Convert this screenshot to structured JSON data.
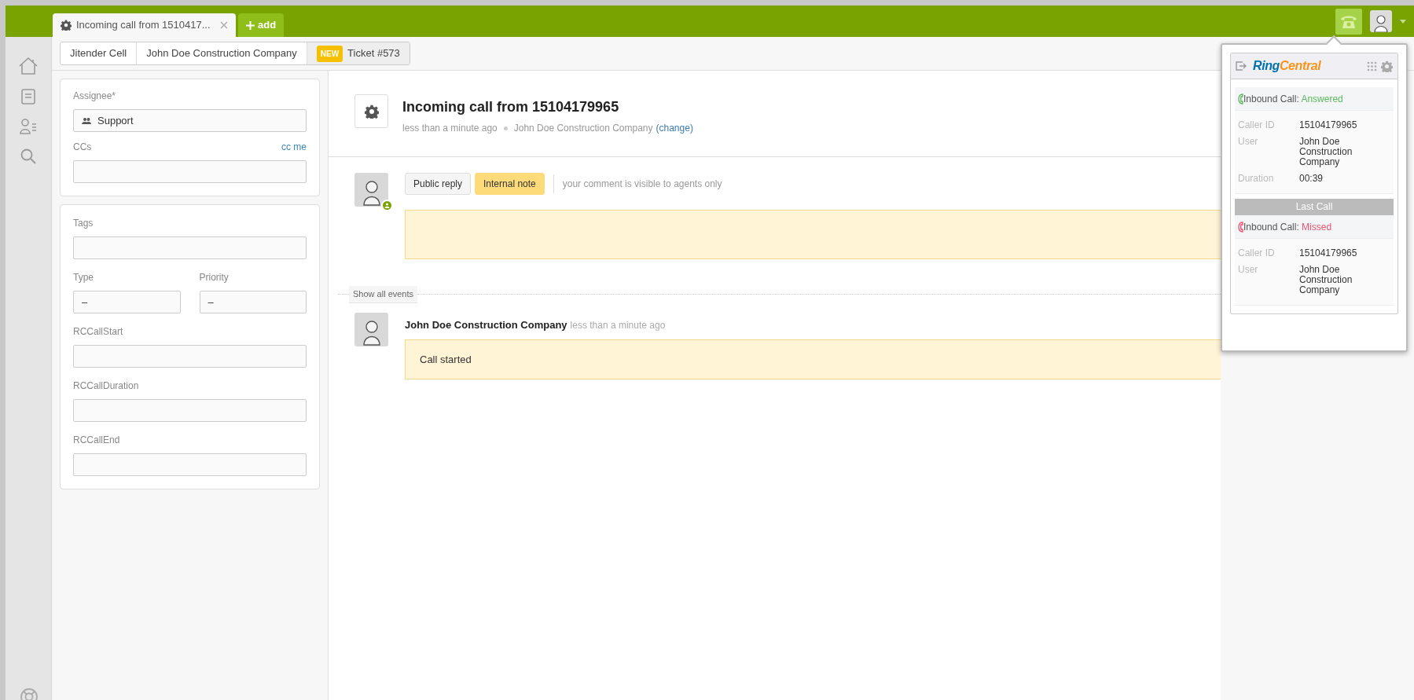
{
  "top_tabs": [
    {
      "label": "Incoming call from 1510417...",
      "selected": true,
      "kind": "ticket"
    },
    {
      "label": "add",
      "selected": false,
      "kind": "add"
    }
  ],
  "breadcrumbs": [
    {
      "label": "Jitender Cell",
      "selected": false
    },
    {
      "label": "John Doe Construction Company",
      "selected": false
    },
    {
      "label": "Ticket #573",
      "badge": "NEW",
      "selected": true
    }
  ],
  "properties": {
    "assignee": {
      "label": "Assignee*",
      "value": "Support"
    },
    "ccs": {
      "label": "CCs",
      "link": "cc me"
    }
  },
  "fields": [
    [
      {
        "label": "Tags"
      }
    ],
    [
      {
        "label": "Type",
        "value": "–"
      },
      {
        "label": "Priority",
        "value": "–"
      }
    ],
    [
      {
        "label": "RCCallStart"
      }
    ],
    [
      {
        "label": "RCCallDuration"
      }
    ],
    [
      {
        "label": "RCCallEnd"
      }
    ]
  ],
  "ticket": {
    "title": "Incoming call from 15104179965",
    "time": "less than a minute ago",
    "requester": "John Doe Construction Company",
    "change_link": "(change)"
  },
  "composer": {
    "modes": [
      {
        "label": "Public reply",
        "selected": false
      },
      {
        "label": "Internal note",
        "selected": true
      }
    ],
    "hint": "your comment is visible to agents only"
  },
  "show_all_events": "Show all events",
  "events": [
    {
      "author": "John Doe Construction Company",
      "time": "less than a minute ago",
      "body": "Call started"
    }
  ],
  "ringcentral": {
    "logo": [
      "Ring",
      "Central"
    ],
    "calls": [
      {
        "label": "Inbound Call:",
        "status": "Answered",
        "color": "#5cb85c",
        "details": [
          {
            "label": "Caller ID",
            "value": "15104179965"
          },
          {
            "label": "User",
            "value": "John Doe Construction Company"
          },
          {
            "label": "Duration",
            "value": "00:39"
          }
        ]
      },
      {
        "heading": "Last Call",
        "label": "Inbound Call:",
        "status": "Missed",
        "color": "#f0506e",
        "details": [
          {
            "label": "Caller ID",
            "value": "15104179965"
          },
          {
            "label": "User",
            "value": "John Doe Construction Company"
          }
        ]
      }
    ]
  }
}
